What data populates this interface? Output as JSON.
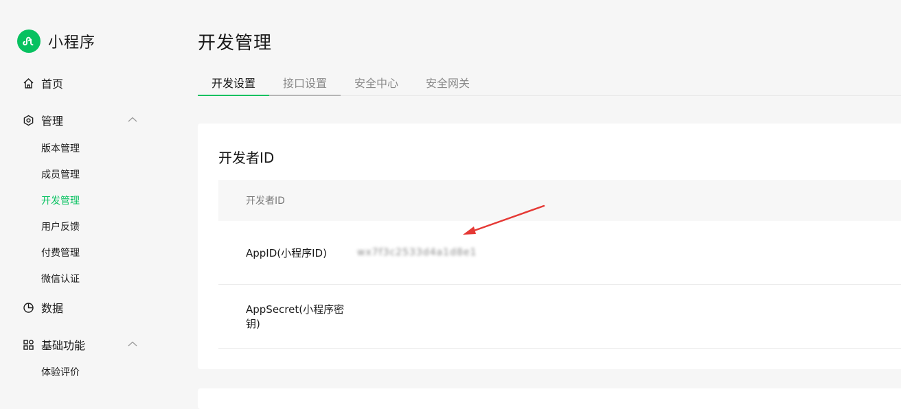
{
  "brand": {
    "name": "小程序",
    "icon": "mini-program-logo-icon",
    "color": "#07c160"
  },
  "sidebar": {
    "items": [
      {
        "label": "首页",
        "icon": "home-icon"
      },
      {
        "label": "管理",
        "icon": "hexagon-gear-icon",
        "expanded": true
      },
      {
        "label": "数据",
        "icon": "pie-chart-icon"
      },
      {
        "label": "基础功能",
        "icon": "grid-apps-icon",
        "expanded": true
      }
    ],
    "manage_sub": [
      {
        "label": "版本管理"
      },
      {
        "label": "成员管理"
      },
      {
        "label": "开发管理",
        "active": true
      },
      {
        "label": "用户反馈"
      },
      {
        "label": "付费管理"
      },
      {
        "label": "微信认证"
      }
    ],
    "basic_sub": [
      {
        "label": "体验评价"
      }
    ]
  },
  "page": {
    "title": "开发管理"
  },
  "tabs": [
    {
      "label": "开发设置",
      "active": true
    },
    {
      "label": "接口设置"
    },
    {
      "label": "安全中心"
    },
    {
      "label": "安全网关"
    }
  ],
  "card": {
    "title": "开发者ID",
    "table_header": "开发者ID",
    "rows": [
      {
        "label": "AppID(小程序ID)",
        "value": "wx7f3c2533d4a1d8e1"
      },
      {
        "label": "AppSecret(小程序密钥)",
        "value": ""
      }
    ]
  },
  "colors": {
    "accent": "#07c160",
    "annotation_arrow": "#e53935"
  }
}
